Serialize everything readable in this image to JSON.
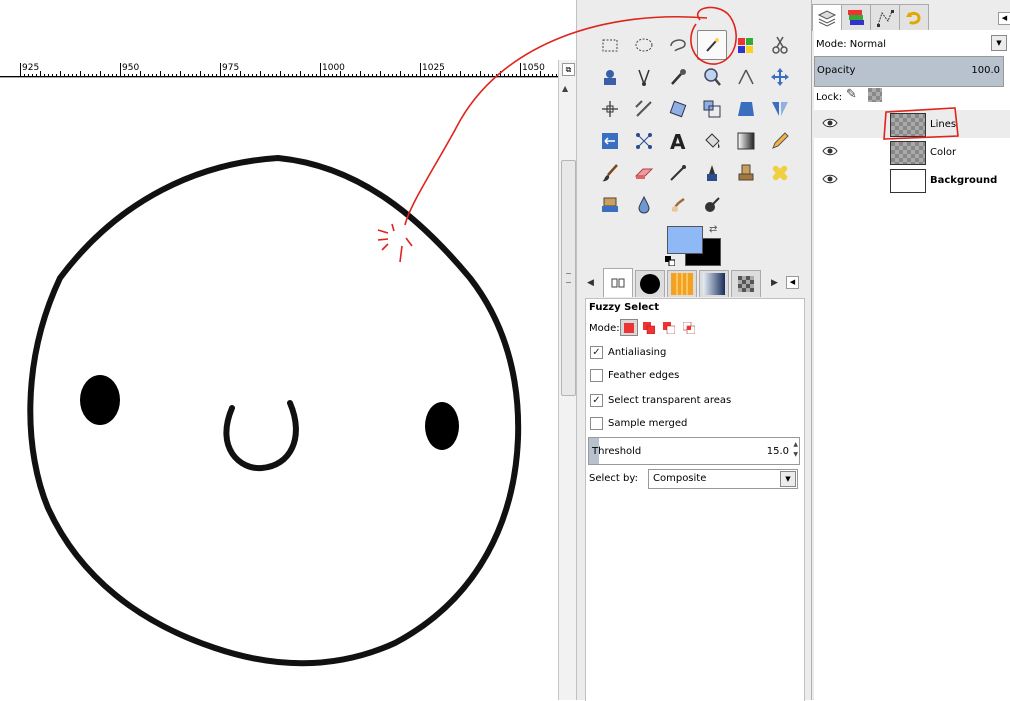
{
  "canvas": {
    "ruler_labels": [
      "925",
      "950",
      "975",
      "1000",
      "1025",
      "1050"
    ]
  },
  "toolbox": {
    "tools": [
      {
        "name": "rect-select-tool-icon"
      },
      {
        "name": "ellipse-select-tool-icon"
      },
      {
        "name": "free-select-tool-icon"
      },
      {
        "name": "fuzzy-select-tool-icon",
        "active": true
      },
      {
        "name": "select-by-color-tool-icon"
      },
      {
        "name": "scissors-select-tool-icon"
      },
      {
        "name": "foreground-select-tool-icon"
      },
      {
        "name": "paths-tool-icon"
      },
      {
        "name": "color-picker-tool-icon"
      },
      {
        "name": "zoom-tool-icon"
      },
      {
        "name": "measure-tool-icon"
      },
      {
        "name": "move-tool-icon"
      },
      {
        "name": "align-tool-icon"
      },
      {
        "name": "crop-tool-icon"
      },
      {
        "name": "rotate-tool-icon"
      },
      {
        "name": "scale-tool-icon"
      },
      {
        "name": "perspective-tool-icon"
      },
      {
        "name": "flip-tool-icon"
      },
      {
        "name": "cage-transform-tool-icon"
      },
      {
        "name": "text-tool-icon"
      },
      {
        "name": "bucket-fill-tool-icon"
      },
      {
        "name": "blend-tool-icon"
      },
      {
        "name": "pencil-tool-icon"
      },
      {
        "name": "paintbrush-tool-icon"
      },
      {
        "name": "eraser-tool-icon"
      },
      {
        "name": "airbrush-tool-icon"
      },
      {
        "name": "ink-tool-icon"
      },
      {
        "name": "clone-tool-icon"
      },
      {
        "name": "heal-tool-icon"
      },
      {
        "name": "perspective-clone-tool-icon"
      },
      {
        "name": "blur-tool-icon"
      },
      {
        "name": "smudge-tool-icon"
      },
      {
        "name": "dodge-burn-tool-icon"
      }
    ],
    "fg_color": "#8fb8f7",
    "bg_color": "#000000"
  },
  "tool_options": {
    "title": "Fuzzy Select",
    "mode_label": "Mode:",
    "antialiasing_label": "Antialiasing",
    "antialiasing_checked": true,
    "feather_label": "Feather edges",
    "feather_checked": false,
    "transparent_label": "Select transparent areas",
    "transparent_checked": true,
    "sample_merged_label": "Sample merged",
    "sample_merged_checked": false,
    "threshold_label": "Threshold",
    "threshold_value": "15.0",
    "select_by_label": "Select by:",
    "select_by_value": "Composite"
  },
  "layers": {
    "mode_label": "Mode: Normal",
    "opacity_label": "Opacity",
    "opacity_value": "100.0",
    "lock_label": "Lock:",
    "items": [
      {
        "name": "Lines",
        "active": true
      },
      {
        "name": "Color",
        "active": false
      },
      {
        "name": "Background",
        "active": false
      }
    ]
  },
  "colors": {
    "annotation_red": "#e0231c",
    "selected_blue": "#b8c2ce"
  }
}
